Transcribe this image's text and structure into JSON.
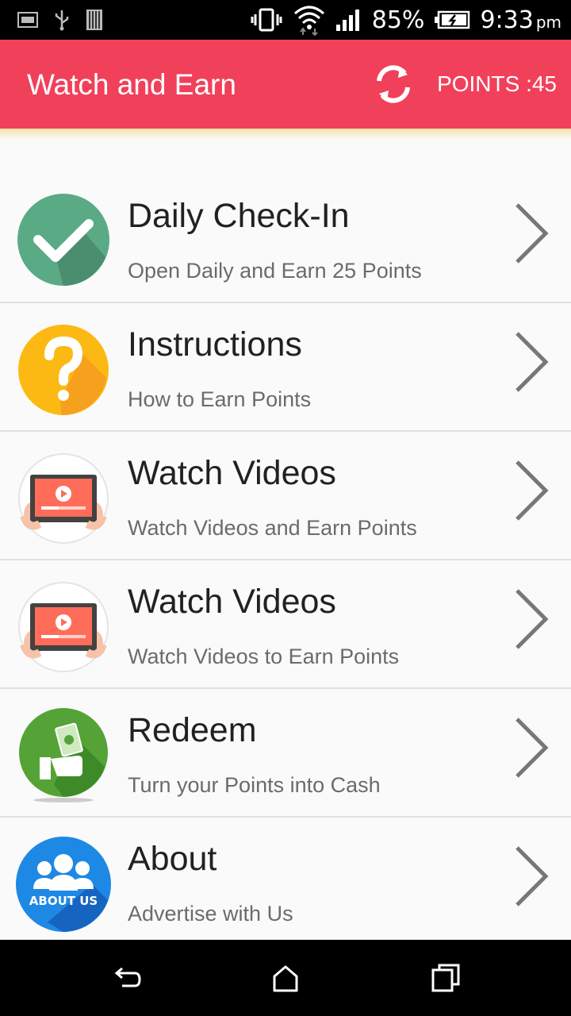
{
  "status_bar": {
    "battery_percent": "85%",
    "time": "9:33",
    "ampm": "pm",
    "icons": [
      "image-icon",
      "usb-icon",
      "sd-card-icon",
      "vibrate-icon",
      "wifi-icon",
      "signal-icon",
      "battery-icon"
    ]
  },
  "app_bar": {
    "title": "Watch and Earn",
    "points_label": "POINTS :45",
    "refresh_icon": "refresh-icon",
    "color": "#f1405a"
  },
  "menu": [
    {
      "title": "Daily Check-In",
      "subtitle": "Open Daily and Earn 25 Points",
      "icon": "check-icon"
    },
    {
      "title": "Instructions",
      "subtitle": "How to Earn Points",
      "icon": "question-icon"
    },
    {
      "title": "Watch Videos",
      "subtitle": "Watch Videos and Earn Points",
      "icon": "video-tablet-icon"
    },
    {
      "title": "Watch Videos",
      "subtitle": "Watch Videos to Earn Points",
      "icon": "video-tablet-icon"
    },
    {
      "title": "Redeem",
      "subtitle": "Turn your Points into Cash",
      "icon": "cash-hand-icon"
    },
    {
      "title": "About",
      "subtitle": "Advertise with Us",
      "icon": "about-us-icon",
      "icon_text": "ABOUT US"
    }
  ],
  "nav_bar": {
    "icons": [
      "back-icon",
      "home-icon",
      "recents-icon"
    ]
  }
}
